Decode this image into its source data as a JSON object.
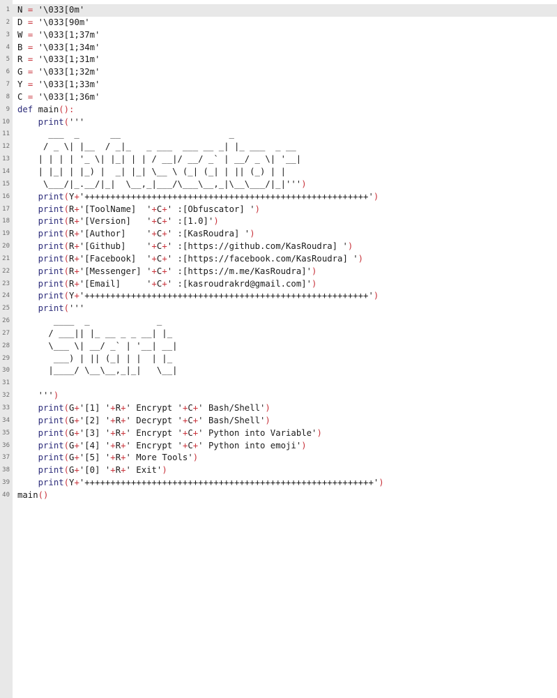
{
  "colors": {
    "background": "#ffffff",
    "gutter": "#e8e8e8",
    "current_line": "#e8e8e8",
    "line_number": "#6e6e6e",
    "text": "#1a1a1a",
    "keyword": "#2c2c7a",
    "operator": "#c8323a"
  },
  "editor": {
    "current_line": 1,
    "lines": [
      [
        {
          "t": "N ",
          "c": "ident"
        },
        {
          "t": "=",
          "c": "op"
        },
        {
          "t": " '\\033[0m'",
          "c": "string"
        }
      ],
      [
        {
          "t": "D ",
          "c": "ident"
        },
        {
          "t": "=",
          "c": "op"
        },
        {
          "t": " '\\033[90m'",
          "c": "string"
        }
      ],
      [
        {
          "t": "W ",
          "c": "ident"
        },
        {
          "t": "=",
          "c": "op"
        },
        {
          "t": " '\\033[1;37m'",
          "c": "string"
        }
      ],
      [
        {
          "t": "B ",
          "c": "ident"
        },
        {
          "t": "=",
          "c": "op"
        },
        {
          "t": " '\\033[1;34m'",
          "c": "string"
        }
      ],
      [
        {
          "t": "R ",
          "c": "ident"
        },
        {
          "t": "=",
          "c": "op"
        },
        {
          "t": " '\\033[1;31m'",
          "c": "string"
        }
      ],
      [
        {
          "t": "G ",
          "c": "ident"
        },
        {
          "t": "=",
          "c": "op"
        },
        {
          "t": " '\\033[1;32m'",
          "c": "string"
        }
      ],
      [
        {
          "t": "Y ",
          "c": "ident"
        },
        {
          "t": "=",
          "c": "op"
        },
        {
          "t": " '\\033[1;33m'",
          "c": "string"
        }
      ],
      [
        {
          "t": "C ",
          "c": "ident"
        },
        {
          "t": "=",
          "c": "op"
        },
        {
          "t": " '\\033[1;36m'",
          "c": "string"
        }
      ],
      [
        {
          "t": "def",
          "c": "keyword"
        },
        {
          "t": " main",
          "c": "ident"
        },
        {
          "t": "():",
          "c": "paren"
        }
      ],
      [
        {
          "t": "    print",
          "c": "builtin"
        },
        {
          "t": "(",
          "c": "paren"
        },
        {
          "t": "'''",
          "c": "string"
        }
      ],
      [
        {
          "t": "      ___  _      __                     _",
          "c": "string"
        }
      ],
      [
        {
          "t": "     / _ \\| |__  / _|_   _ ___  ___ __ _| |_ ___  _ __",
          "c": "string"
        }
      ],
      [
        {
          "t": "    | | | | '_ \\| |_| | | / __|/ __/ _` | __/ _ \\| '__|",
          "c": "string"
        }
      ],
      [
        {
          "t": "    | |_| | |_) |  _| |_| \\__ \\ (_| (_| | || (_) | |",
          "c": "string"
        }
      ],
      [
        {
          "t": "     \\___/|_.__/|_|  \\__,_|___/\\___\\__,_|\\__\\___/|_|'''",
          "c": "string"
        },
        {
          "t": ")",
          "c": "paren"
        }
      ],
      [
        {
          "t": "    print",
          "c": "builtin"
        },
        {
          "t": "(",
          "c": "paren"
        },
        {
          "t": "Y",
          "c": "ident"
        },
        {
          "t": "+",
          "c": "op"
        },
        {
          "t": "'+++++++++++++++++++++++++++++++++++++++++++++++++++++++'",
          "c": "string"
        },
        {
          "t": ")",
          "c": "paren"
        }
      ],
      [
        {
          "t": "    print",
          "c": "builtin"
        },
        {
          "t": "(",
          "c": "paren"
        },
        {
          "t": "R",
          "c": "ident"
        },
        {
          "t": "+",
          "c": "op"
        },
        {
          "t": "'[ToolName]  '",
          "c": "string"
        },
        {
          "t": "+",
          "c": "op"
        },
        {
          "t": "C",
          "c": "ident"
        },
        {
          "t": "+",
          "c": "op"
        },
        {
          "t": "' :[Obfuscator] '",
          "c": "string"
        },
        {
          "t": ")",
          "c": "paren"
        }
      ],
      [
        {
          "t": "    print",
          "c": "builtin"
        },
        {
          "t": "(",
          "c": "paren"
        },
        {
          "t": "R",
          "c": "ident"
        },
        {
          "t": "+",
          "c": "op"
        },
        {
          "t": "'[Version]   '",
          "c": "string"
        },
        {
          "t": "+",
          "c": "op"
        },
        {
          "t": "C",
          "c": "ident"
        },
        {
          "t": "+",
          "c": "op"
        },
        {
          "t": "' :[1.0]'",
          "c": "string"
        },
        {
          "t": ")",
          "c": "paren"
        }
      ],
      [
        {
          "t": "    print",
          "c": "builtin"
        },
        {
          "t": "(",
          "c": "paren"
        },
        {
          "t": "R",
          "c": "ident"
        },
        {
          "t": "+",
          "c": "op"
        },
        {
          "t": "'[Author]    '",
          "c": "string"
        },
        {
          "t": "+",
          "c": "op"
        },
        {
          "t": "C",
          "c": "ident"
        },
        {
          "t": "+",
          "c": "op"
        },
        {
          "t": "' :[KasRoudra] '",
          "c": "string"
        },
        {
          "t": ")",
          "c": "paren"
        }
      ],
      [
        {
          "t": "    print",
          "c": "builtin"
        },
        {
          "t": "(",
          "c": "paren"
        },
        {
          "t": "R",
          "c": "ident"
        },
        {
          "t": "+",
          "c": "op"
        },
        {
          "t": "'[Github]    '",
          "c": "string"
        },
        {
          "t": "+",
          "c": "op"
        },
        {
          "t": "C",
          "c": "ident"
        },
        {
          "t": "+",
          "c": "op"
        },
        {
          "t": "' :[https://github.com/KasRoudra] '",
          "c": "string"
        },
        {
          "t": ")",
          "c": "paren"
        }
      ],
      [
        {
          "t": "    print",
          "c": "builtin"
        },
        {
          "t": "(",
          "c": "paren"
        },
        {
          "t": "R",
          "c": "ident"
        },
        {
          "t": "+",
          "c": "op"
        },
        {
          "t": "'[Facebook]  '",
          "c": "string"
        },
        {
          "t": "+",
          "c": "op"
        },
        {
          "t": "C",
          "c": "ident"
        },
        {
          "t": "+",
          "c": "op"
        },
        {
          "t": "' :[https://facebook.com/KasRoudra] '",
          "c": "string"
        },
        {
          "t": ")",
          "c": "paren"
        }
      ],
      [
        {
          "t": "    print",
          "c": "builtin"
        },
        {
          "t": "(",
          "c": "paren"
        },
        {
          "t": "R",
          "c": "ident"
        },
        {
          "t": "+",
          "c": "op"
        },
        {
          "t": "'[Messenger] '",
          "c": "string"
        },
        {
          "t": "+",
          "c": "op"
        },
        {
          "t": "C",
          "c": "ident"
        },
        {
          "t": "+",
          "c": "op"
        },
        {
          "t": "' :[https://m.me/KasRoudra]'",
          "c": "string"
        },
        {
          "t": ")",
          "c": "paren"
        }
      ],
      [
        {
          "t": "    print",
          "c": "builtin"
        },
        {
          "t": "(",
          "c": "paren"
        },
        {
          "t": "R",
          "c": "ident"
        },
        {
          "t": "+",
          "c": "op"
        },
        {
          "t": "'[Email]     '",
          "c": "string"
        },
        {
          "t": "+",
          "c": "op"
        },
        {
          "t": "C",
          "c": "ident"
        },
        {
          "t": "+",
          "c": "op"
        },
        {
          "t": "' :[kasroudrakrd@gmail.com]'",
          "c": "string"
        },
        {
          "t": ")",
          "c": "paren"
        }
      ],
      [
        {
          "t": "    print",
          "c": "builtin"
        },
        {
          "t": "(",
          "c": "paren"
        },
        {
          "t": "Y",
          "c": "ident"
        },
        {
          "t": "+",
          "c": "op"
        },
        {
          "t": "'+++++++++++++++++++++++++++++++++++++++++++++++++++++++'",
          "c": "string"
        },
        {
          "t": ")",
          "c": "paren"
        }
      ],
      [
        {
          "t": "    print",
          "c": "builtin"
        },
        {
          "t": "(",
          "c": "paren"
        },
        {
          "t": "'''",
          "c": "string"
        }
      ],
      [
        {
          "t": "       ____  _             _",
          "c": "string"
        }
      ],
      [
        {
          "t": "      / ___|| |_ __ _ _ __| |_",
          "c": "string"
        }
      ],
      [
        {
          "t": "      \\___ \\| __/ _` | '__| __|",
          "c": "string"
        }
      ],
      [
        {
          "t": "       ___) | || (_| | |  | |_",
          "c": "string"
        }
      ],
      [
        {
          "t": "      |____/ \\__\\__,_|_|   \\__|",
          "c": "string"
        }
      ],
      [],
      [
        {
          "t": "    '''",
          "c": "string"
        },
        {
          "t": ")",
          "c": "paren"
        }
      ],
      [
        {
          "t": "    print",
          "c": "builtin"
        },
        {
          "t": "(",
          "c": "paren"
        },
        {
          "t": "G",
          "c": "ident"
        },
        {
          "t": "+",
          "c": "op"
        },
        {
          "t": "'[1] '",
          "c": "string"
        },
        {
          "t": "+",
          "c": "op"
        },
        {
          "t": "R",
          "c": "ident"
        },
        {
          "t": "+",
          "c": "op"
        },
        {
          "t": "' Encrypt '",
          "c": "string"
        },
        {
          "t": "+",
          "c": "op"
        },
        {
          "t": "C",
          "c": "ident"
        },
        {
          "t": "+",
          "c": "op"
        },
        {
          "t": "' Bash/Shell'",
          "c": "string"
        },
        {
          "t": ")",
          "c": "paren"
        }
      ],
      [
        {
          "t": "    print",
          "c": "builtin"
        },
        {
          "t": "(",
          "c": "paren"
        },
        {
          "t": "G",
          "c": "ident"
        },
        {
          "t": "+",
          "c": "op"
        },
        {
          "t": "'[2] '",
          "c": "string"
        },
        {
          "t": "+",
          "c": "op"
        },
        {
          "t": "R",
          "c": "ident"
        },
        {
          "t": "+",
          "c": "op"
        },
        {
          "t": "' Decrypt '",
          "c": "string"
        },
        {
          "t": "+",
          "c": "op"
        },
        {
          "t": "C",
          "c": "ident"
        },
        {
          "t": "+",
          "c": "op"
        },
        {
          "t": "' Bash/Shell'",
          "c": "string"
        },
        {
          "t": ")",
          "c": "paren"
        }
      ],
      [
        {
          "t": "    print",
          "c": "builtin"
        },
        {
          "t": "(",
          "c": "paren"
        },
        {
          "t": "G",
          "c": "ident"
        },
        {
          "t": "+",
          "c": "op"
        },
        {
          "t": "'[3] '",
          "c": "string"
        },
        {
          "t": "+",
          "c": "op"
        },
        {
          "t": "R",
          "c": "ident"
        },
        {
          "t": "+",
          "c": "op"
        },
        {
          "t": "' Encrypt '",
          "c": "string"
        },
        {
          "t": "+",
          "c": "op"
        },
        {
          "t": "C",
          "c": "ident"
        },
        {
          "t": "+",
          "c": "op"
        },
        {
          "t": "' Python into Variable'",
          "c": "string"
        },
        {
          "t": ")",
          "c": "paren"
        }
      ],
      [
        {
          "t": "    print",
          "c": "builtin"
        },
        {
          "t": "(",
          "c": "paren"
        },
        {
          "t": "G",
          "c": "ident"
        },
        {
          "t": "+",
          "c": "op"
        },
        {
          "t": "'[4] '",
          "c": "string"
        },
        {
          "t": "+",
          "c": "op"
        },
        {
          "t": "R",
          "c": "ident"
        },
        {
          "t": "+",
          "c": "op"
        },
        {
          "t": "' Encrypt '",
          "c": "string"
        },
        {
          "t": "+",
          "c": "op"
        },
        {
          "t": "C",
          "c": "ident"
        },
        {
          "t": "+",
          "c": "op"
        },
        {
          "t": "' Python into emoji'",
          "c": "string"
        },
        {
          "t": ")",
          "c": "paren"
        }
      ],
      [
        {
          "t": "    print",
          "c": "builtin"
        },
        {
          "t": "(",
          "c": "paren"
        },
        {
          "t": "G",
          "c": "ident"
        },
        {
          "t": "+",
          "c": "op"
        },
        {
          "t": "'[5] '",
          "c": "string"
        },
        {
          "t": "+",
          "c": "op"
        },
        {
          "t": "R",
          "c": "ident"
        },
        {
          "t": "+",
          "c": "op"
        },
        {
          "t": "' More Tools'",
          "c": "string"
        },
        {
          "t": ")",
          "c": "paren"
        }
      ],
      [
        {
          "t": "    print",
          "c": "builtin"
        },
        {
          "t": "(",
          "c": "paren"
        },
        {
          "t": "G",
          "c": "ident"
        },
        {
          "t": "+",
          "c": "op"
        },
        {
          "t": "'[0] '",
          "c": "string"
        },
        {
          "t": "+",
          "c": "op"
        },
        {
          "t": "R",
          "c": "ident"
        },
        {
          "t": "+",
          "c": "op"
        },
        {
          "t": "' Exit'",
          "c": "string"
        },
        {
          "t": ")",
          "c": "paren"
        }
      ],
      [
        {
          "t": "    print",
          "c": "builtin"
        },
        {
          "t": "(",
          "c": "paren"
        },
        {
          "t": "Y",
          "c": "ident"
        },
        {
          "t": "+",
          "c": "op"
        },
        {
          "t": "'++++++++++++++++++++++++++++++++++++++++++++++++++++++++'",
          "c": "string"
        },
        {
          "t": ")",
          "c": "paren"
        }
      ],
      [
        {
          "t": "main",
          "c": "ident"
        },
        {
          "t": "()",
          "c": "paren"
        }
      ]
    ]
  }
}
